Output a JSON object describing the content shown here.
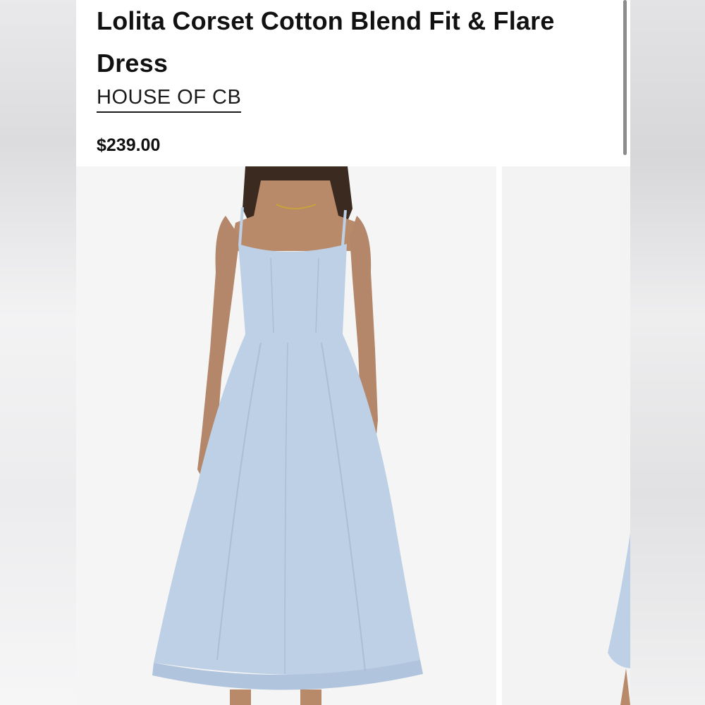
{
  "product": {
    "title": "Lolita Corset Cotton Blend Fit & Flare Dress",
    "brand": "HOUSE OF CB",
    "price": "$239.00"
  },
  "gallery": {
    "images": [
      {
        "alt": "model-wearing-dress-front"
      },
      {
        "alt": "model-wearing-dress-partial"
      }
    ]
  },
  "colors": {
    "dress": "#bdd0e6",
    "dress_shadow": "#a9bfd8",
    "skin": "#b98a6a",
    "hair": "#3b2a20",
    "background": "#f5f5f5"
  }
}
